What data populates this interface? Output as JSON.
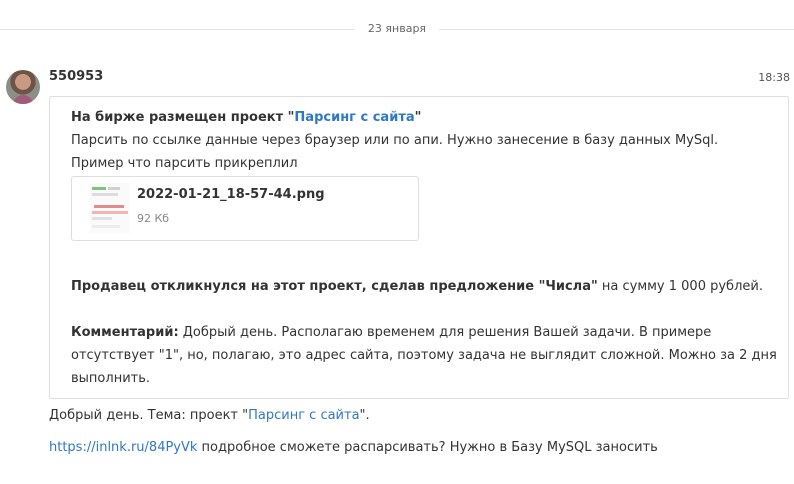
{
  "date_separator": "23 января",
  "message": {
    "author": "550953",
    "time": "18:38",
    "card": {
      "intro_prefix": "На бирже размещен проект ",
      "quote_open": "\"",
      "project_link": "Парсинг с сайта",
      "quote_close": "\"",
      "description_line1": "Парсить по ссылке данные через браузер или по апи. Нужно занесение в базу данных MySql.",
      "description_line2": "Пример что парсить прикреплил",
      "attachment": {
        "file_name": "2022-01-21_18-57-44.png",
        "file_size": "92 Кб"
      },
      "offer_bold": "Продавец откликнулся на этот проект, сделав предложение \"Числа\"",
      "offer_rest": " на сумму 1 000 рублей.",
      "comment_label": "Комментарий:",
      "comment_line1": " Добрый день. Располагаю временем для решения Вашей задачи. В примере",
      "comment_line2": "отсутствует \"1\", но, полагаю, это адрес сайта, поэтому задача не выглядит сложной. Можно за 2 дня",
      "comment_line3": "выполнить."
    },
    "reply1_prefix": "Добрый день. Тема: проект ",
    "reply1_quote_open": "\"",
    "reply1_link": "Парсинг с сайта",
    "reply1_quote_close": "\".",
    "reply2_link": "https://inlnk.ru/84PyVk",
    "reply2_text": " подробное сможете распарсивать? Нужно в Базу MySQL заносить"
  },
  "colors": {
    "link": "#2f78c4",
    "text": "#333333",
    "border": "#e0e0e0"
  }
}
